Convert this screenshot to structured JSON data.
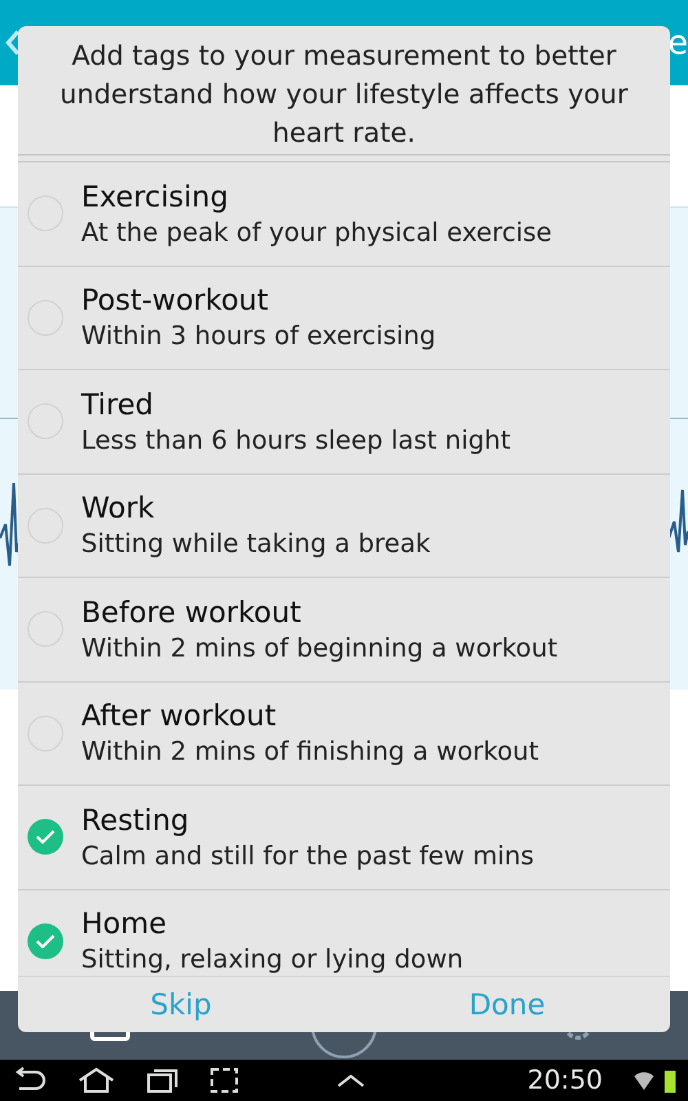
{
  "app_bar": {
    "title_fragment": "e"
  },
  "dialog": {
    "message": "Add tags to your measurement to better understand how your lifestyle affects your heart rate.",
    "tags": [
      {
        "title": "Exercising",
        "description": "At the peak of your physical exercise",
        "checked": false
      },
      {
        "title": "Post-workout",
        "description": "Within 3 hours of exercising",
        "checked": false
      },
      {
        "title": "Tired",
        "description": "Less than 6 hours sleep last night",
        "checked": false
      },
      {
        "title": "Work",
        "description": "Sitting while taking a break",
        "checked": false
      },
      {
        "title": "Before workout",
        "description": "Within 2 mins of beginning a workout",
        "checked": false
      },
      {
        "title": "After workout",
        "description": "Within 2 mins of finishing a workout",
        "checked": false
      },
      {
        "title": "Resting",
        "description": "Calm and still for the past few mins",
        "checked": true
      },
      {
        "title": "Home",
        "description": "Sitting, relaxing or lying down",
        "checked": true
      }
    ],
    "buttons": [
      "Skip",
      "Done"
    ]
  },
  "system_bar": {
    "time": "20:50"
  }
}
